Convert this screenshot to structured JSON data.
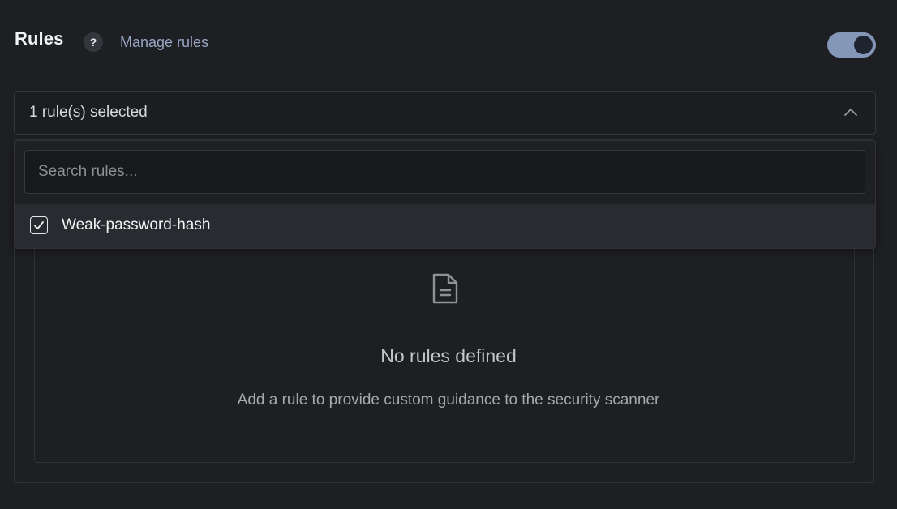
{
  "header": {
    "title": "Rules",
    "help_label": "?",
    "manage_link": "Manage rules",
    "toggle_on": true
  },
  "select": {
    "value": "1 rule(s) selected",
    "expanded": true
  },
  "dropdown": {
    "search_placeholder": "Search rules...",
    "options": [
      {
        "label": "Weak-password-hash",
        "checked": true
      }
    ]
  },
  "empty_state": {
    "title": "No rules defined",
    "subtitle": "Add a rule to provide custom guidance to the security scanner"
  },
  "colors": {
    "background": "#1e1f23",
    "accent_link": "#96a6c4",
    "toggle_track": "#8597b8"
  },
  "icons": [
    "help-icon",
    "chevron-up-icon",
    "check-icon",
    "document-icon"
  ]
}
